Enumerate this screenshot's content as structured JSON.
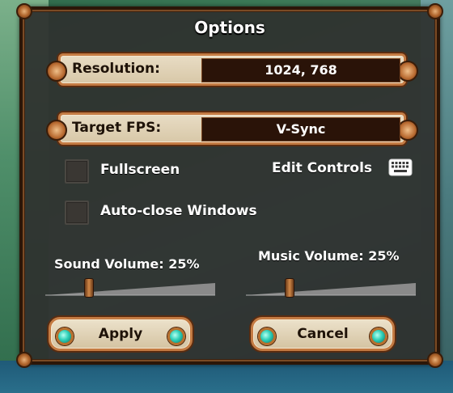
{
  "window": {
    "title": "Options"
  },
  "settings": {
    "resolution": {
      "label": "Resolution:",
      "value": "1024, 768"
    },
    "target_fps": {
      "label": "Target FPS:",
      "value": "V-Sync"
    }
  },
  "checkboxes": {
    "fullscreen": {
      "label": "Fullscreen",
      "checked": false
    },
    "auto_close": {
      "label": "Auto-close Windows",
      "checked": false
    }
  },
  "edit_controls": {
    "label": "Edit Controls",
    "icon": "keyboard-icon"
  },
  "volume": {
    "sound": {
      "label": "Sound Volume: 25%",
      "level": 0.25
    },
    "music": {
      "label": "Music Volume: 25%",
      "level": 0.25
    }
  },
  "buttons": {
    "apply": "Apply",
    "cancel": "Cancel"
  },
  "colors": {
    "panel": "#2e302e",
    "frame": "#c47b43",
    "value_box": "#2a1308",
    "gem": "#2fd0b8"
  }
}
